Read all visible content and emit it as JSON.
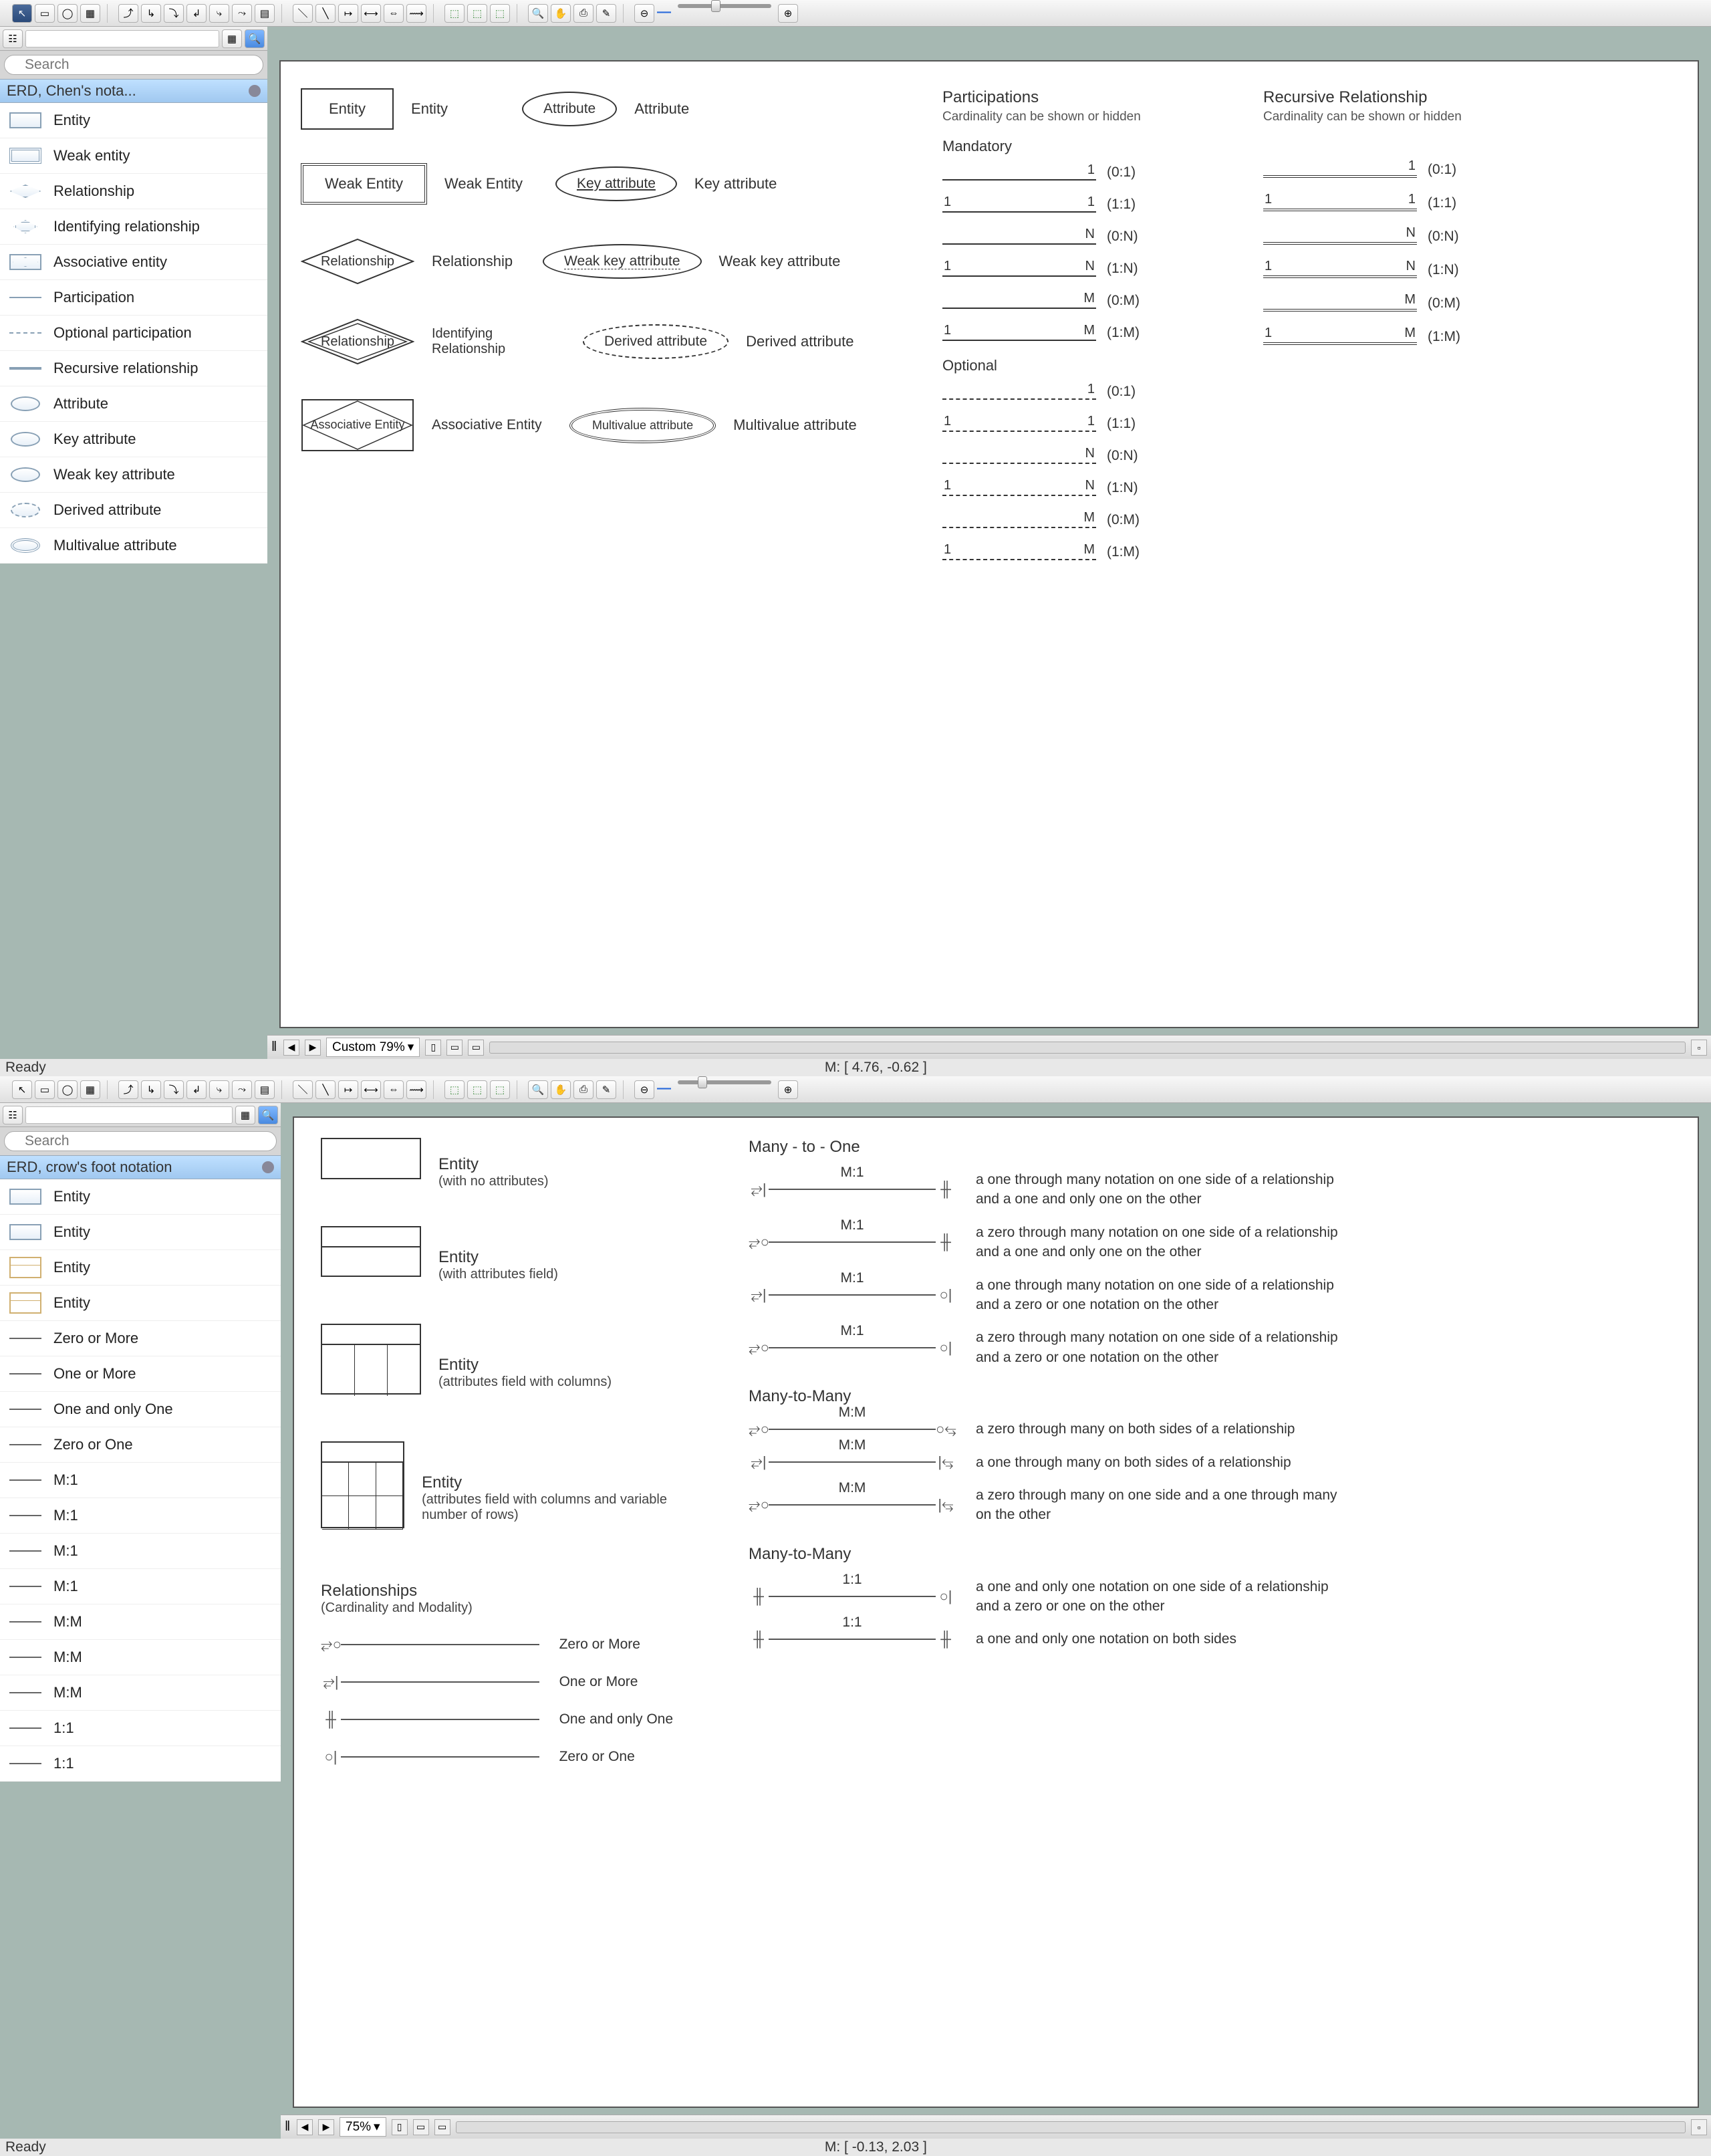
{
  "window1": {
    "search_placeholder": "Search",
    "panel_title": "ERD, Chen's nota...",
    "stencils": [
      "Entity",
      "Weak entity",
      "Relationship",
      "Identifying relationship",
      "Associative entity",
      "Participation",
      "Optional participation",
      "Recursive relationship",
      "Attribute",
      "Key attribute",
      "Weak key attribute",
      "Derived attribute",
      "Multivalue attribute"
    ],
    "canvas": {
      "shapes": [
        {
          "shape": "Entity",
          "label": "Entity"
        },
        {
          "shape": "Weak Entity",
          "label": "Weak Entity"
        },
        {
          "shape": "Relationship",
          "label": "Relationship"
        },
        {
          "shape": "Relationship",
          "label": "Identifying Relationship"
        },
        {
          "shape": "Associative Entity",
          "label": "Associative Entity"
        }
      ],
      "attrs": [
        {
          "shape": "Attribute",
          "label": "Attribute"
        },
        {
          "shape": "Key attribute",
          "label": "Key attribute"
        },
        {
          "shape": "Weak key attribute",
          "label": "Weak key attribute"
        },
        {
          "shape": "Derived attribute",
          "label": "Derived attribute"
        },
        {
          "shape": "Multivalue attribute",
          "label": "Multivalue attribute"
        }
      ],
      "participations_title": "Participations",
      "participations_sub": "Cardinality can be shown or hidden",
      "recursive_title": "Recursive Relationship",
      "recursive_sub": "Cardinality can be shown or hidden",
      "mandatory_label": "Mandatory",
      "optional_label": "Optional",
      "parts_mandatory": [
        {
          "l": "",
          "r": "1",
          "lab": "(0:1)"
        },
        {
          "l": "1",
          "r": "1",
          "lab": "(1:1)"
        },
        {
          "l": "",
          "r": "N",
          "lab": "(0:N)"
        },
        {
          "l": "1",
          "r": "N",
          "lab": "(1:N)"
        },
        {
          "l": "",
          "r": "M",
          "lab": "(0:M)"
        },
        {
          "l": "1",
          "r": "M",
          "lab": "(1:M)"
        }
      ],
      "parts_optional": [
        {
          "l": "",
          "r": "1",
          "lab": "(0:1)"
        },
        {
          "l": "1",
          "r": "1",
          "lab": "(1:1)"
        },
        {
          "l": "",
          "r": "N",
          "lab": "(0:N)"
        },
        {
          "l": "1",
          "r": "N",
          "lab": "(1:N)"
        },
        {
          "l": "",
          "r": "M",
          "lab": "(0:M)"
        },
        {
          "l": "1",
          "r": "M",
          "lab": "(1:M)"
        }
      ]
    },
    "zoom": "Custom 79%",
    "status_ready": "Ready",
    "status_coords": "M: [  4.76, -0.62  ]"
  },
  "window2": {
    "search_placeholder": "Search",
    "panel_title": "ERD, crow's foot notation",
    "stencils": [
      "Entity",
      "Entity",
      "Entity",
      "Entity",
      "Zero or More",
      "One or More",
      "One and only One",
      "Zero or One",
      "M:1",
      "M:1",
      "M:1",
      "M:1",
      "M:M",
      "M:M",
      "M:M",
      "1:1",
      "1:1"
    ],
    "canvas": {
      "entities": [
        {
          "title": "Entity",
          "sub": "(with no attributes)"
        },
        {
          "title": "Entity",
          "sub": "(with attributes field)"
        },
        {
          "title": "Entity",
          "sub": "(attributes field with columns)"
        },
        {
          "title": "Entity",
          "sub": "(attributes field with columns and variable number of rows)"
        }
      ],
      "rel_heading": "Relationships",
      "rel_sub": "(Cardinality and Modality)",
      "rel_basics": [
        "Zero or More",
        "One or More",
        "One and only One",
        "Zero or One"
      ],
      "m1_title": "Many - to - One",
      "m1": [
        {
          "txt": "M:1",
          "desc": "a one through many notation on one side of a relationship and a one and only one on the other"
        },
        {
          "txt": "M:1",
          "desc": "a zero through many notation on one side of a relationship and a one and only one on the other"
        },
        {
          "txt": "M:1",
          "desc": "a one through many notation on one side of a relationship and a zero or one notation on the other"
        },
        {
          "txt": "M:1",
          "desc": "a zero through many notation on one side of a relationship and a zero or one notation on the other"
        }
      ],
      "mm_title": "Many-to-Many",
      "mm": [
        {
          "txt": "M:M",
          "desc": "a zero through many on both sides of a relationship"
        },
        {
          "txt": "M:M",
          "desc": "a one through many on both sides of a relationship"
        },
        {
          "txt": "M:M",
          "desc": "a zero through many on one side and a one through many on the other"
        }
      ],
      "oo_title": "Many-to-Many",
      "oo": [
        {
          "txt": "1:1",
          "desc": "a one and only one notation on one side of a relationship and a zero or one on the other"
        },
        {
          "txt": "1:1",
          "desc": "a one and only one notation on both sides"
        }
      ]
    },
    "zoom": "75%",
    "status_ready": "Ready",
    "status_coords": "M: [  -0.13, 2.03  ]"
  }
}
